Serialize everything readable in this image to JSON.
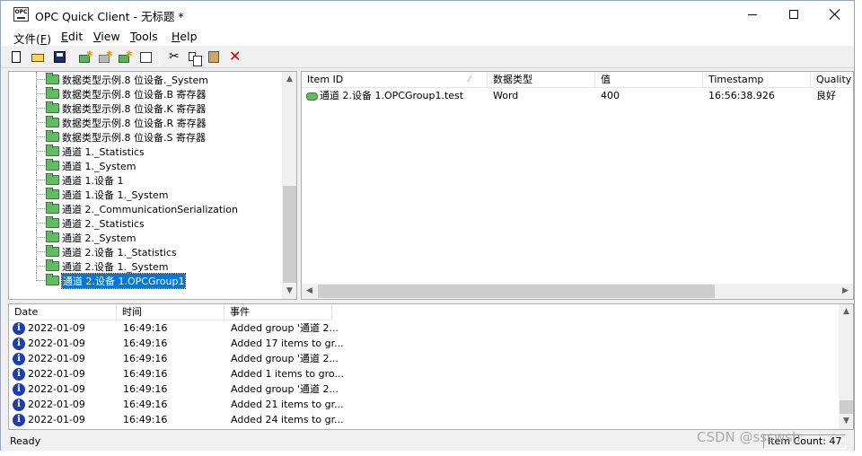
{
  "window": {
    "title": "OPC Quick Client - 无标题 *"
  },
  "menu": [
    {
      "text": "文件(",
      "key": "F",
      "suffix": ")"
    },
    {
      "text": "",
      "key": "E",
      "suffix": "dit"
    },
    {
      "text": "",
      "key": "V",
      "suffix": "iew"
    },
    {
      "text": "",
      "key": "T",
      "suffix": "ools"
    },
    {
      "text": "",
      "key": "H",
      "suffix": "elp"
    }
  ],
  "toolbar": {
    "icons": [
      "new-file-icon",
      "open-folder-icon",
      "save-icon",
      "new-server-icon",
      "new-group-icon",
      "new-item-icon",
      "properties-icon",
      "cut-icon",
      "copy-icon",
      "paste-icon",
      "delete-icon"
    ]
  },
  "tree": {
    "items": [
      "数据类型示例.8 位设备._System",
      "数据类型示例.8 位设备.B 寄存器",
      "数据类型示例.8 位设备.K 寄存器",
      "数据类型示例.8 位设备.R 寄存器",
      "数据类型示例.8 位设备.S 寄存器",
      "通道 1._Statistics",
      "通道 1._System",
      "通道 1.设备 1",
      "通道 1.设备 1._System",
      "通道 2._CommunicationSerialization",
      "通道 2._Statistics",
      "通道 2._System",
      "通道 2.设备 1._Statistics",
      "通道 2.设备 1._System",
      "通道 2.设备 1.OPCGroup1"
    ],
    "selected_index": 14
  },
  "items": {
    "headers": [
      "Item ID",
      "数据类型",
      "值",
      "Timestamp",
      "Quality"
    ],
    "rows": [
      {
        "item_id": "通道 2.设备 1.OPCGroup1.test",
        "type": "Word",
        "value": "400",
        "timestamp": "16:56:38.926",
        "quality": "良好"
      }
    ]
  },
  "log": {
    "headers": [
      "Date",
      "时间",
      "事件"
    ],
    "rows": [
      {
        "date": "2022-01-09",
        "time": "16:49:16",
        "event": "Added group '通道 2..."
      },
      {
        "date": "2022-01-09",
        "time": "16:49:16",
        "event": "Added 17 items to gr..."
      },
      {
        "date": "2022-01-09",
        "time": "16:49:16",
        "event": "Added group '通道 2..."
      },
      {
        "date": "2022-01-09",
        "time": "16:49:16",
        "event": "Added 1 items to gro..."
      },
      {
        "date": "2022-01-09",
        "time": "16:49:16",
        "event": "Added group '通道 2..."
      },
      {
        "date": "2022-01-09",
        "time": "16:49:16",
        "event": "Added 21 items to gr..."
      },
      {
        "date": "2022-01-09",
        "time": "16:49:16",
        "event": "Added 24 items to gr..."
      }
    ]
  },
  "status": {
    "text": "Ready",
    "item_count": "Item Count: 47"
  },
  "watermark": "CSDN @ssswsh",
  "colors": {
    "selection": "#0078d7",
    "folder": "#5fbf5f",
    "info": "#1f3fa8",
    "delete": "#cc0000"
  }
}
